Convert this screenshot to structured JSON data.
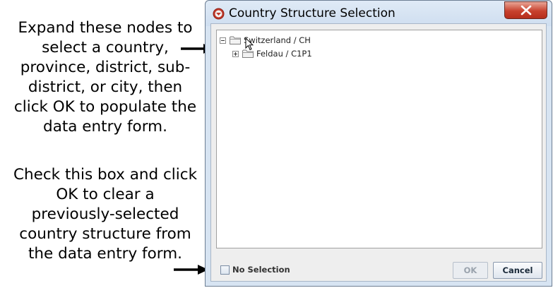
{
  "annotations": {
    "top_text": "Expand these nodes to\nselect a country,\nprovince, district, sub-\ndistrict, or city, then\nclick OK to populate the\ndata entry form.",
    "bottom_text": "Check this box and click\nOK to clear a\npreviously-selected\ncountry structure from\nthe data entry form."
  },
  "dialog": {
    "title": "Country Structure Selection",
    "tree": {
      "nodes": [
        {
          "label": "Switzerland / CH",
          "expanded": true,
          "level": 0
        },
        {
          "label": "Feldau / C1P1",
          "expanded": false,
          "level": 1
        }
      ]
    },
    "no_selection_label": "No Selection",
    "no_selection_checked": false,
    "ok_label": "OK",
    "ok_enabled": false,
    "cancel_label": "Cancel"
  },
  "colors": {
    "window_frame": "#d7e4f2",
    "close_button": "#c8412e",
    "app_icon": "#c0392b"
  },
  "icons": {
    "app": "red-circle-chevron-icon",
    "close": "close-x-icon",
    "folder": "folder-icon",
    "cursor": "mouse-pointer-icon",
    "arrow": "arrow-right-icon"
  }
}
